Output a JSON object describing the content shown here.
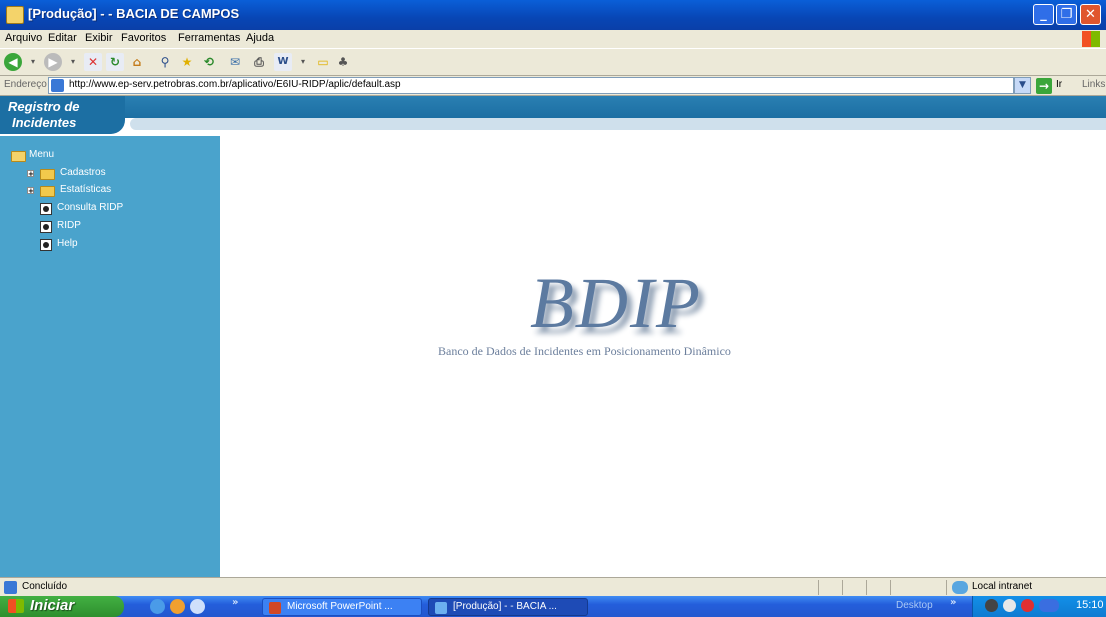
{
  "window": {
    "title": "[Produção] - - BACIA DE CAMPOS",
    "buttons": {
      "minimize": "_",
      "restore": "❐",
      "close": "✕"
    }
  },
  "menubar": [
    "Arquivo",
    "Editar",
    "Exibir",
    "Favoritos",
    "Ferramentas",
    "Ajuda"
  ],
  "address": {
    "label": "Endereço",
    "url": "http://www.ep-serv.petrobras.com.br/aplicativo/E6IU-RIDP/aplic/default.asp",
    "go_label": "Ir",
    "links_label": "Links"
  },
  "app": {
    "logo_line1": "Registro de",
    "logo_line2": "Incidentes"
  },
  "sidebar": {
    "root": "Menu",
    "items": [
      {
        "label": "Cadastros",
        "type": "folder",
        "expandable": true
      },
      {
        "label": "Estatísticas",
        "type": "folder",
        "expandable": true
      },
      {
        "label": "Consulta RIDP",
        "type": "page"
      },
      {
        "label": "RIDP",
        "type": "page"
      },
      {
        "label": "Help",
        "type": "page"
      }
    ]
  },
  "main": {
    "heading": "BDIP",
    "subtitle": "Banco de Dados de Incidentes em Posicionamento Dinâmico"
  },
  "statusbar": {
    "text": "Concluído",
    "zone": "Local intranet"
  },
  "taskbar": {
    "start_label": "Iniciar",
    "tasks": [
      "Microsoft PowerPoint ...",
      "[Produção] - - BACIA ..."
    ],
    "desktop_label": "Desktop",
    "clock": "15:10"
  },
  "colors": {
    "sidebar": "#4aa3cc",
    "titlebar": "#0846b5",
    "banner": "#1c6fa3",
    "heading": "#5c7aa0"
  }
}
